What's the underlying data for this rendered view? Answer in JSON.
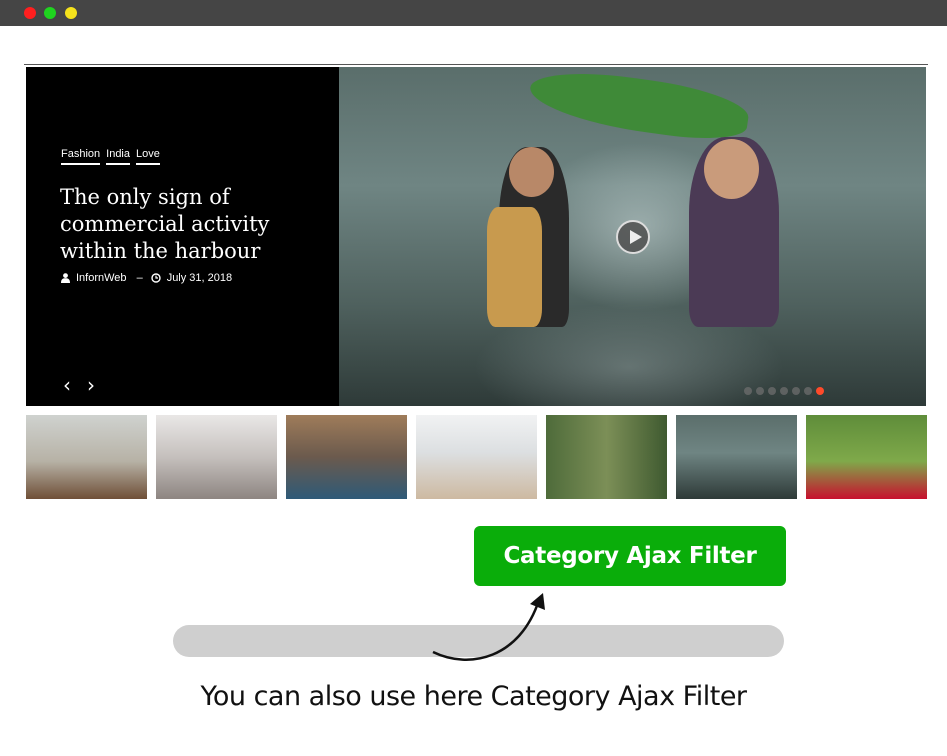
{
  "window": {
    "controls": [
      {
        "name": "close",
        "color": "#ff1f1f"
      },
      {
        "name": "minimize",
        "color": "#1fd41f"
      },
      {
        "name": "maximize",
        "color": "#f5e21c"
      }
    ]
  },
  "slider": {
    "tags": [
      "Fashion",
      "India",
      "Love"
    ],
    "title": "The only sign of commercial activity within the harbour",
    "author": "InfornWeb",
    "separator": "–",
    "date": "July 31, 2018",
    "prev_label": "‹",
    "next_label": "›",
    "dots_count": 7,
    "active_dot": 6,
    "play_icon": "play-icon"
  },
  "thumbnails": [
    {
      "name": "thumb-woman-armchair"
    },
    {
      "name": "thumb-couple-hearts"
    },
    {
      "name": "thumb-woman-sofa"
    },
    {
      "name": "thumb-mother-child-beach"
    },
    {
      "name": "thumb-woman-forest"
    },
    {
      "name": "thumb-kids-rain"
    },
    {
      "name": "thumb-woman-picnic"
    }
  ],
  "filter_button": {
    "label": "Category Ajax Filter",
    "color": "#0aad0a"
  },
  "caption": "You can also use here Category Ajax Filter"
}
